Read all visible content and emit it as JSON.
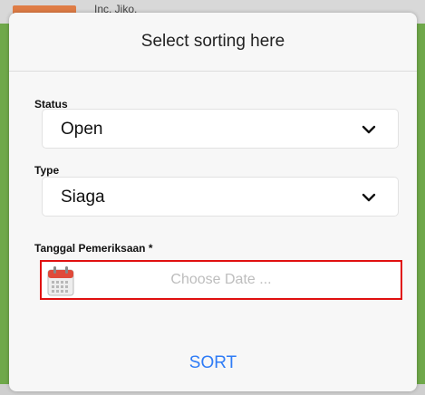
{
  "background": {
    "top_text": "Inc. Jiko."
  },
  "modal": {
    "title": "Select sorting here",
    "status": {
      "label": "Status",
      "value": "Open"
    },
    "type": {
      "label": "Type",
      "value": "Siaga"
    },
    "date": {
      "label": "Tanggal Pemeriksaan *",
      "placeholder": "Choose Date ..."
    },
    "sort_label": "SORT"
  },
  "colors": {
    "accent": "#2f7cf6",
    "error_border": "#e01010",
    "frame": "#6fa84a"
  },
  "icons": [
    "chevron-down-icon",
    "calendar-icon"
  ]
}
